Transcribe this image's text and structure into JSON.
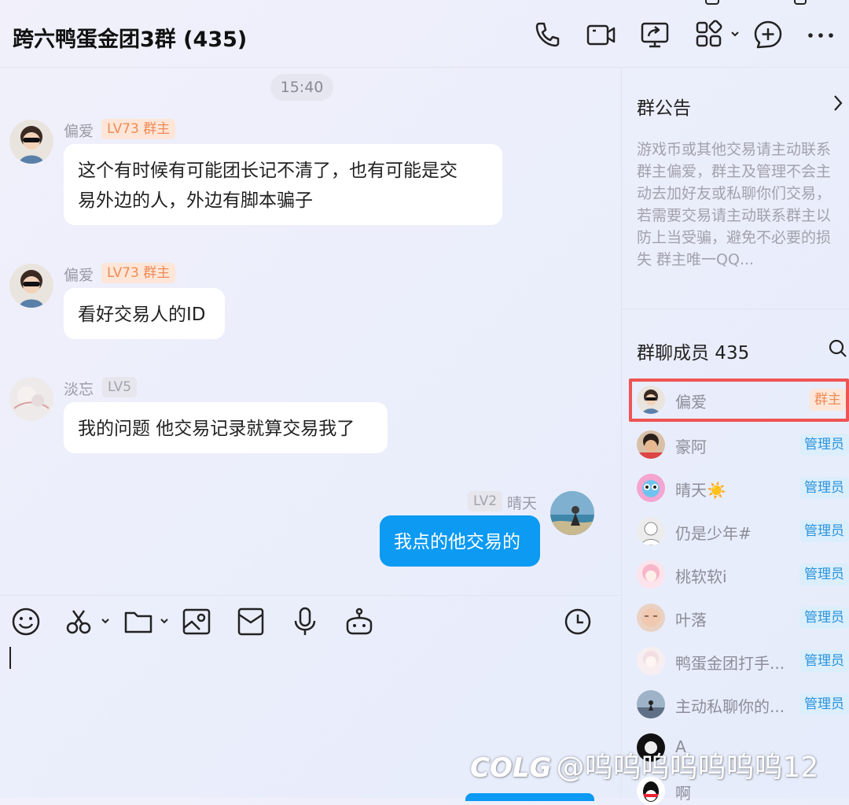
{
  "header": {
    "title": "跨六鸭蛋金团3群 (435)",
    "icons": [
      "phone-icon",
      "video-call-icon",
      "screen-share-icon",
      "apps-icon",
      "add-member-icon",
      "more-icon"
    ]
  },
  "chat": {
    "time": "15:40",
    "messages": [
      {
        "sender": "偏爱",
        "badge": "LV73 群主",
        "text_lines": [
          "这个有时候有可能团长记不清了，也有可能是交",
          "易外边的人，外边有脚本骗子"
        ]
      },
      {
        "sender": "偏爱",
        "badge": "LV73 群主",
        "text": "看好交易人的ID"
      },
      {
        "sender": "淡忘",
        "badge": "LV5",
        "text": "我的问题  他交易记录就算交易我了"
      },
      {
        "sender": "晴天",
        "badge": "LV2",
        "text": "我点的他交易的",
        "self": true
      }
    ]
  },
  "toolbar": {
    "icons": [
      "emoji-icon",
      "screenshot-icon",
      "folder-icon",
      "image-icon",
      "red-packet-icon",
      "microphone-icon",
      "robot-icon",
      "history-icon"
    ]
  },
  "notice": {
    "title": "群公告",
    "lines": [
      "游戏币或其他交易请主动联系",
      "群主偏爱，群主及管理不会主",
      "动去加好友或私聊你们交易，",
      "若需要交易请主动联系群主以",
      "防上当受骗，避免不必要的损",
      "失 群主唯一QQ..."
    ]
  },
  "members": {
    "title": "群聊成员 435",
    "list": [
      {
        "name": "偏爱",
        "role": "群主"
      },
      {
        "name": "豪阿",
        "role": "管理员"
      },
      {
        "name": "晴天☀️",
        "role": "管理员"
      },
      {
        "name": "仍是少年#",
        "role": "管理员"
      },
      {
        "name": "桃软软i",
        "role": "管理员"
      },
      {
        "name": "叶落",
        "role": "管理员"
      },
      {
        "name": "鸭蛋金团打手...",
        "role": "管理员"
      },
      {
        "name": "主动私聊你的...",
        "role": "管理员"
      },
      {
        "name": "A",
        "role": ""
      },
      {
        "name": "啊",
        "role": ""
      }
    ]
  },
  "watermark": {
    "logo": "COLG",
    "text": "@呜呜呜呜呜呜呜12"
  },
  "colors": {
    "accent": "#0c9af2",
    "owner_badge": "#f08a55",
    "admin_badge": "#2b93dd",
    "highlight": "#ef5454"
  }
}
